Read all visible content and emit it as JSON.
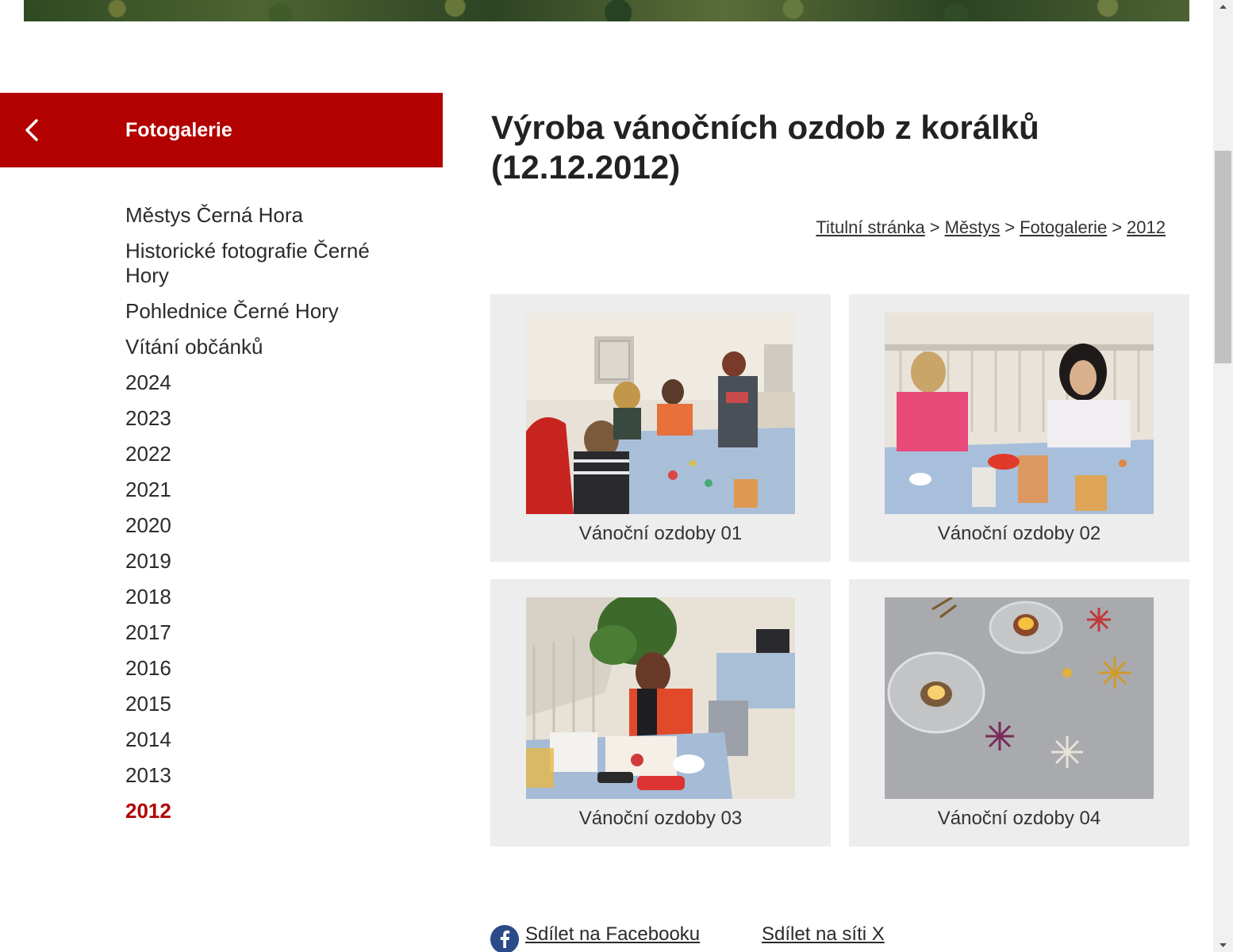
{
  "sidebar": {
    "header_title": "Fotogalerie",
    "back_icon": "chevron-left-icon",
    "items": [
      {
        "label": "Městys Černá Hora"
      },
      {
        "label": "Historické fotografie Černé Hory"
      },
      {
        "label": "Pohlednice Černé Hory"
      },
      {
        "label": "Vítání občánků"
      },
      {
        "label": "2024"
      },
      {
        "label": "2023"
      },
      {
        "label": "2022"
      },
      {
        "label": "2021"
      },
      {
        "label": "2020"
      },
      {
        "label": "2019"
      },
      {
        "label": "2018"
      },
      {
        "label": "2017"
      },
      {
        "label": "2016"
      },
      {
        "label": "2015"
      },
      {
        "label": "2014"
      },
      {
        "label": "2013"
      },
      {
        "label": "2012",
        "active": true
      }
    ]
  },
  "main": {
    "title": "Výroba vánočních ozdob z korálků (12.12.2012)",
    "breadcrumb": {
      "items": [
        "Titulní stránka",
        "Městys",
        "Fotogalerie",
        "2012"
      ],
      "separator": ">"
    },
    "gallery": [
      {
        "caption": "Vánoční ozdoby 01"
      },
      {
        "caption": "Vánoční ozdoby 02"
      },
      {
        "caption": "Vánoční ozdoby 03"
      },
      {
        "caption": "Vánoční ozdoby 04"
      }
    ]
  },
  "share": {
    "facebook_label": "Sdílet na Facebooku",
    "facebook_icon": "facebook-icon",
    "x_label": "Sdílet na síti X"
  },
  "colors": {
    "accent": "#b30000",
    "card_bg": "#ededed",
    "text": "#2a2a2a"
  }
}
